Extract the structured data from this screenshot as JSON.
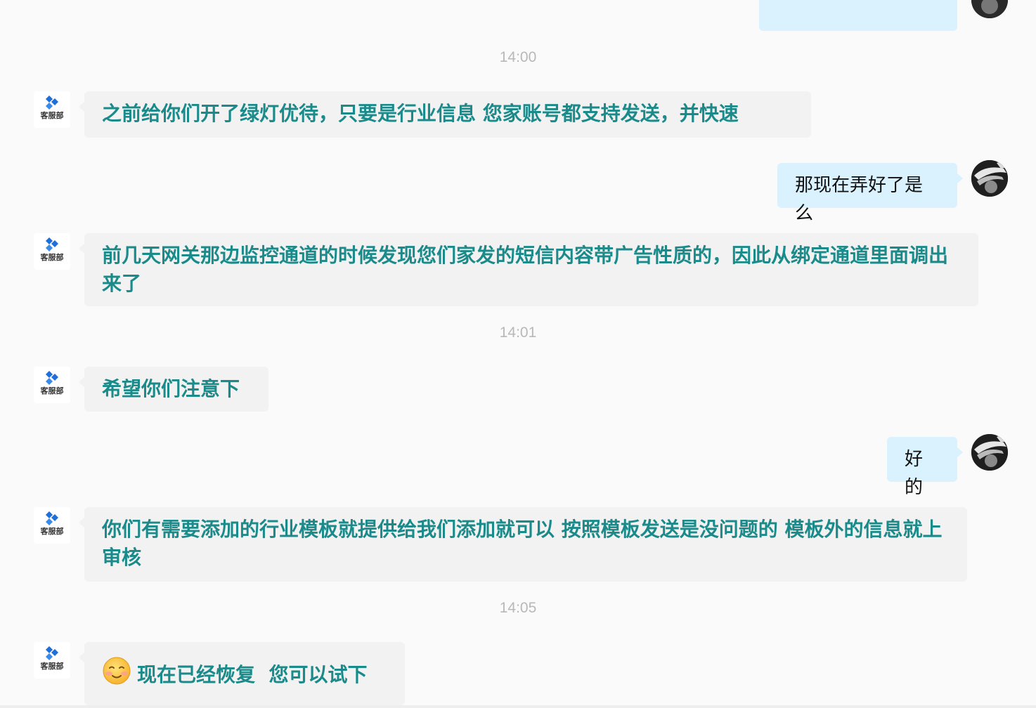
{
  "agent_label": "客服部",
  "colors": {
    "agent_text": "#1a8a8a",
    "agent_bubble": "#f2f2f2",
    "user_bubble": "#d9f2fd",
    "timestamp": "#b8b8b8",
    "logo_blue": "#1e6fd9"
  },
  "timestamps": [
    "14:00",
    "14:01",
    "14:05"
  ],
  "messages": [
    {
      "from": "agent",
      "text": "之前给你们开了绿灯优待，只要是行业信息 您家账号都支持发送，并快速"
    },
    {
      "from": "user",
      "text": "那现在弄好了是么"
    },
    {
      "from": "agent",
      "text": "前几天网关那边监控通道的时候发现您们家发的短信内容带广告性质的，因此从绑定通道里面调出来了"
    },
    {
      "from": "agent",
      "text": "希望你们注意下"
    },
    {
      "from": "user",
      "text": "好的"
    },
    {
      "from": "agent",
      "text": "你们有需要添加的行业模板就提供给我们添加就可以 按照模板发送是没问题的 模板外的信息就上审核"
    },
    {
      "from": "agent",
      "icon": "blushing-smile-emoji",
      "text": "现在已经恢复  您可以试下"
    }
  ]
}
